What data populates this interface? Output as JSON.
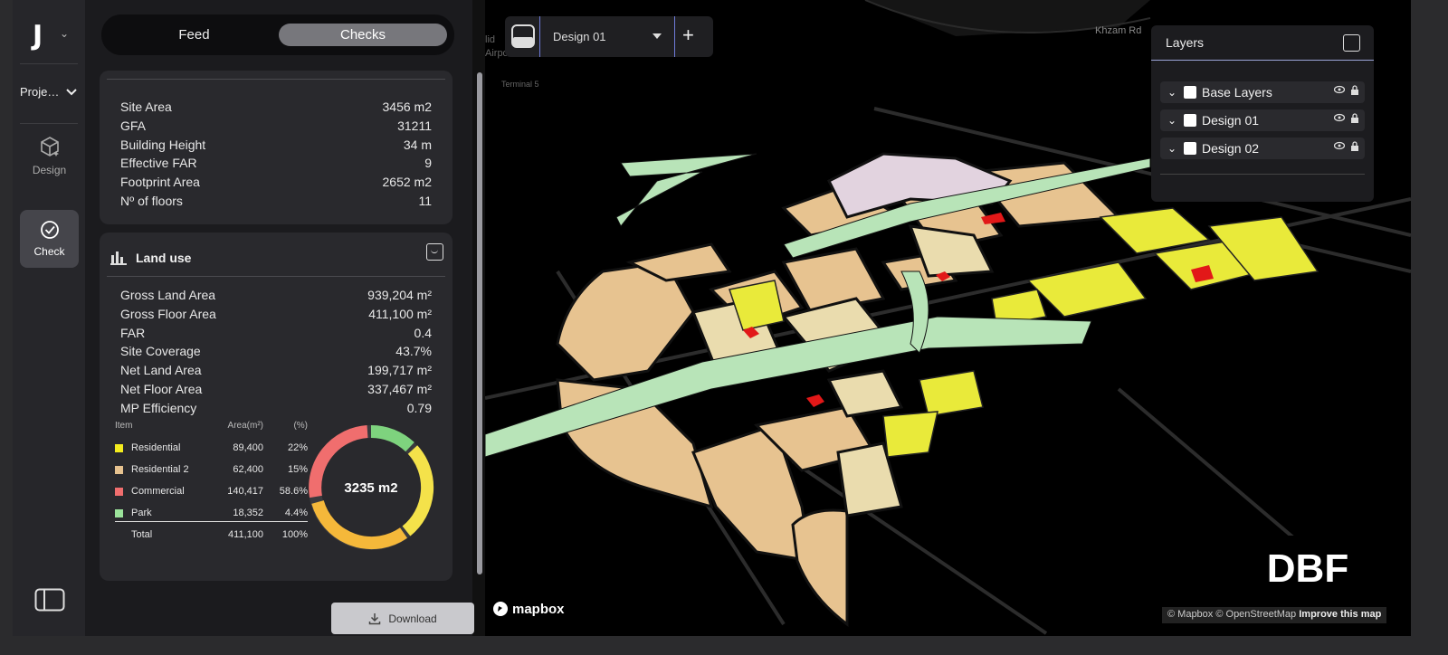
{
  "app": {
    "logo": "J"
  },
  "rail": {
    "project_label": "Proje…",
    "items": [
      {
        "label": "Design",
        "icon": "cube-icon"
      },
      {
        "label": "Check",
        "icon": "check-circle-icon"
      }
    ]
  },
  "panel": {
    "tabs": [
      "Feed",
      "Checks"
    ],
    "active_tab": "Checks",
    "site_stats": [
      {
        "label": "Site Area",
        "value": "3456 m2"
      },
      {
        "label": "GFA",
        "value": "31211"
      },
      {
        "label": "Building Height",
        "value": "34 m"
      },
      {
        "label": "Effective FAR",
        "value": "9"
      },
      {
        "label": "Footprint Area",
        "value": "2652 m2"
      },
      {
        "label": "Nº of floors",
        "value": "11"
      }
    ],
    "land_use": {
      "title": "Land use",
      "stats": [
        {
          "label": "Gross Land Area",
          "value": "939,204 m²"
        },
        {
          "label": "Gross Floor Area",
          "value": "411,100 m²"
        },
        {
          "label": "FAR",
          "value": "0.4"
        },
        {
          "label": "Site Coverage",
          "value": "43.7%"
        },
        {
          "label": "Net Land Area",
          "value": "199,717 m²"
        },
        {
          "label": "Net Floor Area",
          "value": "337,467 m²"
        },
        {
          "label": "MP Efficiency",
          "value": "0.79"
        }
      ],
      "table_headers": {
        "item": "Item",
        "area": "Area(m²)",
        "pct": "(%)"
      },
      "rows": [
        {
          "item": "Residential",
          "area": "89,400",
          "pct": "22%",
          "color": "#f4ec1e"
        },
        {
          "item": "Residential 2",
          "area": "62,400",
          "pct": "15%",
          "color": "#e6c28f"
        },
        {
          "item": "Commercial",
          "area": "140,417",
          "pct": "58.6%",
          "color": "#f06e6e"
        },
        {
          "item": "Park",
          "area": "18,352",
          "pct": "4.4%",
          "color": "#9be39b"
        }
      ],
      "total": {
        "item": "Total",
        "area": "411,100",
        "pct": "100%"
      },
      "donut_center": "3235 m2"
    },
    "download_label": "Download"
  },
  "map": {
    "design_select": "Design 01",
    "add_label": "+",
    "layers_title": "Layers",
    "layers": [
      {
        "label": "Base Layers"
      },
      {
        "label": "Design 01"
      },
      {
        "label": "Design 02"
      }
    ],
    "mapbox": "mapbox",
    "attribution_prefix": "© Mapbox © OpenStreetMap",
    "attribution_link": "Improve this map",
    "labels": [
      "lid",
      "Airport",
      "Terminal 5",
      "Khzam Rd"
    ],
    "watermark": "DBF"
  },
  "colors": {
    "residential": "#f4ec1e",
    "residential2": "#e6c28f",
    "commercial": "#f06e6e",
    "park": "#9be39b",
    "accent": "#6e7bd9"
  }
}
